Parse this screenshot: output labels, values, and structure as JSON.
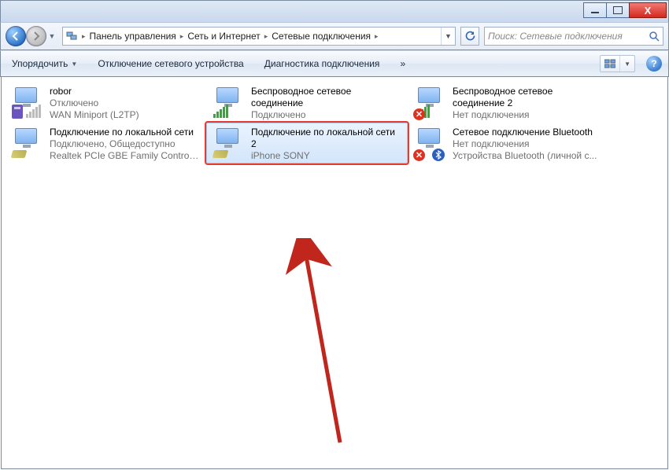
{
  "titlebar": {
    "minimize": "",
    "maximize": "",
    "close": ""
  },
  "breadcrumbs": [
    "Панель управления",
    "Сеть и Интернет",
    "Сетевые подключения"
  ],
  "search_placeholder": "Поиск: Сетевые подключения",
  "commands": {
    "organize": "Упорядочить",
    "disable": "Отключение сетевого устройства",
    "diagnose": "Диагностика подключения",
    "more": "»"
  },
  "items": [
    {
      "name": "robor",
      "status": "Отключено",
      "device": "WAN Miniport (L2TP)",
      "icon": "dial",
      "selected": false
    },
    {
      "name": "Беспроводное сетевое соединение",
      "status": "Подключено",
      "device": "",
      "icon": "wifi-on",
      "selected": false
    },
    {
      "name": "Беспроводное сетевое соединение 2",
      "status": "Нет подключения",
      "device": "",
      "icon": "wifi-off",
      "selected": false
    },
    {
      "name": "Подключение по локальной сети",
      "status": "Подключено, Общедоступно",
      "device": "Realtek PCIe GBE Family Controller",
      "icon": "lan",
      "selected": false
    },
    {
      "name": "Подключение по локальной сети 2",
      "status": "",
      "device": "iPhone SONY",
      "icon": "lan",
      "selected": true
    },
    {
      "name": "Сетевое подключение Bluetooth",
      "status": "Нет подключения",
      "device": "Устройства Bluetooth (личной с...",
      "icon": "bt-off",
      "selected": false
    }
  ]
}
